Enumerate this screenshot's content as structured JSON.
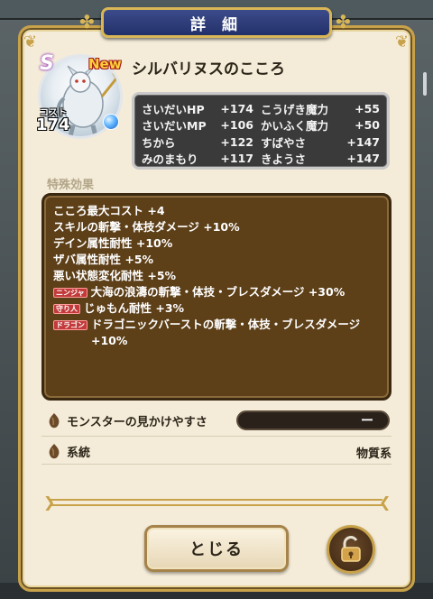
{
  "dialog": {
    "title": "詳 細"
  },
  "monster": {
    "rank": "S",
    "new_label": "New",
    "name": "シルバリヌスのこころ",
    "cost_label": "コスト",
    "cost_value": "174"
  },
  "stats": [
    {
      "name": "さいだいHP",
      "value": "+174",
      "name2": "こうげき魔力",
      "value2": "+55"
    },
    {
      "name": "さいだいMP",
      "value": "+106",
      "name2": "かいふく魔力",
      "value2": "+50"
    },
    {
      "name": "ちから",
      "value": "+122",
      "name2": "すばやさ",
      "value2": "+147"
    },
    {
      "name": "みのまもり",
      "value": "+117",
      "name2": "きようさ",
      "value2": "+147"
    }
  ],
  "effects_section": {
    "label": "特殊効果",
    "lines": [
      {
        "tag": "",
        "text": "こころ最大コスト +4"
      },
      {
        "tag": "",
        "text": "スキルの斬撃・体技ダメージ +10%"
      },
      {
        "tag": "",
        "text": "デイン属性耐性 +10%"
      },
      {
        "tag": "",
        "text": "ザバ属性耐性 +5%"
      },
      {
        "tag": "",
        "text": "悪い状態変化耐性 +5%"
      },
      {
        "tag": "ニンジャ",
        "text": "大海の浪濤の斬撃・体技・ブレスダメージ +30%"
      },
      {
        "tag": "守り人",
        "text": "じゅもん耐性 +3%"
      },
      {
        "tag": "ドラゴン",
        "text": "ドラゴニックバーストの斬撃・体技・ブレスダメージ +10%"
      }
    ]
  },
  "attributes": {
    "visibility_label": "モンスターの見かけやすさ",
    "visibility_value": "ー",
    "lineage_label": "系統",
    "lineage_value": "物質系"
  },
  "buttons": {
    "close_label": "とじる"
  },
  "icons": {
    "type_orb": "water-orb-icon",
    "attr_icon": "seed-icon",
    "lock": "unlock-icon"
  }
}
